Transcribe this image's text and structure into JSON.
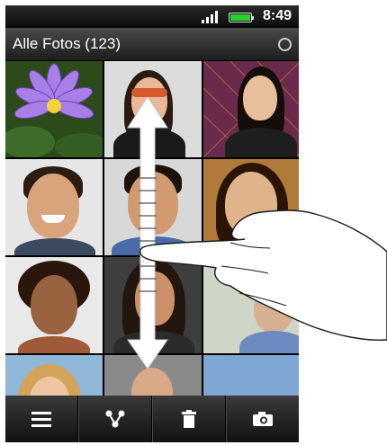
{
  "status": {
    "time": "8:49",
    "signal_icon": "signal-icon",
    "battery_icon": "battery-icon"
  },
  "header": {
    "title": "Alle Fotos (123)",
    "sync_icon": "loading-spinner-icon"
  },
  "gallery": {
    "thumbnails": [
      {
        "subject": "purple water lily"
      },
      {
        "subject": "woman with sunglasses"
      },
      {
        "subject": "smiling woman"
      },
      {
        "subject": "smiling man"
      },
      {
        "subject": "smiling man"
      },
      {
        "subject": "smiling woman"
      },
      {
        "subject": "smiling woman"
      },
      {
        "subject": "man with long hair"
      },
      {
        "subject": "man"
      },
      {
        "subject": "woman"
      },
      {
        "subject": "bald man"
      },
      {
        "subject": "sky"
      }
    ]
  },
  "gesture": {
    "arrow_icon": "vertical-double-arrow-icon",
    "hand_icon": "pointing-hand-icon"
  },
  "toolbar": {
    "buttons": [
      {
        "icon": "menu-icon"
      },
      {
        "icon": "share-icon"
      },
      {
        "icon": "delete-icon"
      },
      {
        "icon": "camera-icon"
      }
    ]
  }
}
